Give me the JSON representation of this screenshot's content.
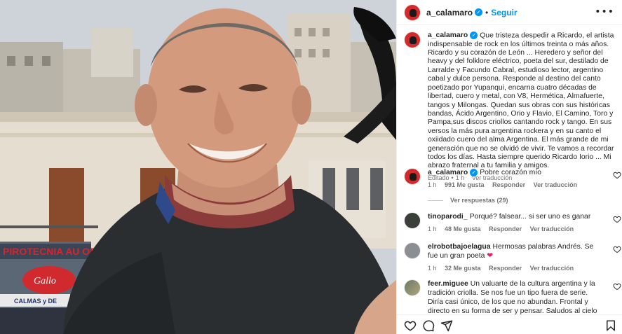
{
  "post": {
    "author": "a_calamaro",
    "follow_label": "Seguir",
    "separator": "•",
    "more_label": "•••",
    "caption": "Que tristeza despedir a Ricardo, el artista indispensable de rock en los últimos treinta o más años. Ricardo y su corazón de León ... Heredero y señor del heavy y del folklore eléctrico, poeta del sur, destilado de Larralde y Facundo Cabral, estudioso lector, argentino cabal y dulce persona. Responde al destino del canto poetizado por Yupanqui, encarna cuatro décadas de libertad, cuero y metal, con V8, Hermética, Almafuerte, tangos y Milongas. Quedan sus obras con sus históricas bandas, Ácido Argentino, Orio y Flavio, El Camino, Toro y Pampa,sus discos criollos cantando rock y tango. En sus versos la más pura argentina rockera y en su canto el oxiidado cuero del alma Argentina. El más grande de mi generación que no se olvidó de vivir. Te vamos a recordar todos los días. Hasta siempre querido Ricardo Iorio ... Mi abrazo fraternal a tu familia y amigos.",
    "caption_meta": {
      "edited": "Editado",
      "time": "1 h",
      "translate": "Ver traducción"
    }
  },
  "comments": [
    {
      "user": "a_calamaro",
      "text": "Pobre corazón mío",
      "time": "1 h",
      "likes": "991 Me gusta",
      "reply": "Responder",
      "translate": "Ver traducción",
      "view_replies": "Ver respuestas (29)"
    },
    {
      "user": "tinoparodi_",
      "text": "Porqué? falsear... si ser uno es ganar",
      "time": "1 h",
      "likes": "48 Me gusta",
      "reply": "Responder",
      "translate": "Ver traducción"
    },
    {
      "user": "elrobotbajoelagua",
      "text": "Hermosas palabras Andrés. Se fue un gran poeta",
      "emoji": "❤",
      "time": "1 h",
      "likes": "32 Me gusta",
      "reply": "Responder",
      "translate": "Ver traducción"
    },
    {
      "user": "feer.miguee",
      "text": "Un valuarte de la cultura argentina y la tradición criolla. Se nos fue un tipo fuera de serie. Diría casi único, de los que no abundan. Frontal y directo en su forma de ser y pensar. Saludos al cielo Andrelo !"
    }
  ],
  "photo": {
    "sign_text": "PIROTECNIA AU ORE",
    "sign_secondary": "CALMAS y DE",
    "sign_logo": "Gallo"
  },
  "icons": {
    "heart": "heart-icon",
    "comment": "comment-icon",
    "share": "share-icon",
    "bookmark": "bookmark-icon",
    "verified": "verified-badge-icon"
  },
  "colors": {
    "link_blue": "#0095f6",
    "avatar_red": "#d52a2a",
    "muted_text": "#737373",
    "emoji_red": "#e0245e"
  }
}
